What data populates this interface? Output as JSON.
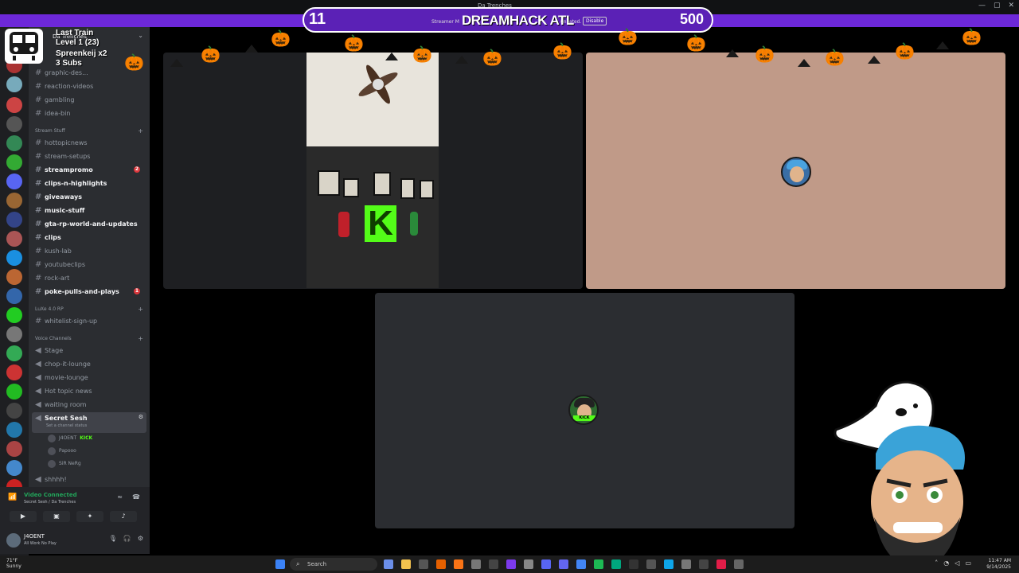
{
  "window": {
    "title": "Da Trenches",
    "controls": [
      "—",
      "▢",
      "✕"
    ]
  },
  "overlay": {
    "left_count": "11",
    "right_count": "500",
    "center_title": "DREAMHACK ATL",
    "streamer_text": "Streamer M",
    "truncated_text": "uncated.",
    "disable_label": "Disable"
  },
  "level": {
    "line1": "Last Train",
    "line2": "Level 1 (23)",
    "line3": "Spreenkeij x2",
    "line4": "3 Subs"
  },
  "server": {
    "name": "Da Trenches"
  },
  "channels": [
    {
      "label": "graphic-des...",
      "bold": false
    },
    {
      "label": "reaction-videos",
      "bold": false
    },
    {
      "label": "gambling",
      "bold": false
    },
    {
      "label": "idea-bin",
      "bold": false
    }
  ],
  "category_stream": "Stream Stuff",
  "stream_channels": [
    {
      "label": "hottopicnews",
      "bold": false,
      "badge": ""
    },
    {
      "label": "stream-setups",
      "bold": false,
      "badge": ""
    },
    {
      "label": "streampromo",
      "bold": true,
      "badge": "2"
    },
    {
      "label": "clips-n-highlights",
      "bold": true,
      "badge": ""
    },
    {
      "label": "giveaways",
      "bold": true,
      "badge": ""
    },
    {
      "label": "music-stuff",
      "bold": true,
      "badge": ""
    },
    {
      "label": "gta-rp-world-and-updates",
      "bold": true,
      "badge": ""
    },
    {
      "label": "clips",
      "bold": true,
      "badge": ""
    },
    {
      "label": "kush-lab",
      "bold": false,
      "badge": ""
    },
    {
      "label": "youtubeclips",
      "bold": false,
      "badge": ""
    },
    {
      "label": "rock-art",
      "bold": false,
      "badge": ""
    },
    {
      "label": "poke-pulls-and-plays",
      "bold": true,
      "badge": "1"
    }
  ],
  "category_luxe": "LuXe 4.0 RP",
  "luxe_channels": [
    {
      "label": "whitelist-sign-up"
    }
  ],
  "category_voice": "Voice Channels",
  "voice_channels": [
    {
      "label": "Stage"
    },
    {
      "label": "chop-it-lounge"
    },
    {
      "label": "movie-lounge"
    },
    {
      "label": "Hot topic news"
    },
    {
      "label": "waiting room"
    }
  ],
  "active_voice": {
    "label": "Secret Sesh",
    "status": "Set a channel status"
  },
  "voice_users": [
    {
      "name": "J4OENT",
      "tag": "KICK"
    },
    {
      "name": "Papooo",
      "tag": ""
    },
    {
      "name": "SiR NeRg",
      "tag": ""
    }
  ],
  "last_channel": "shhhh!",
  "voice_panel": {
    "title": "Video Connected",
    "subtitle": "Secret Sesh / Da Trenches"
  },
  "user": {
    "name": "J4OENT",
    "status": "All Work No Play"
  },
  "taskbar": {
    "weather_temp": "71°F",
    "weather_desc": "Sunny",
    "search_label": "Search",
    "time": "11:47 AM",
    "date": "9/14/2025"
  },
  "tile_tags": {
    "kick": "KICK"
  }
}
